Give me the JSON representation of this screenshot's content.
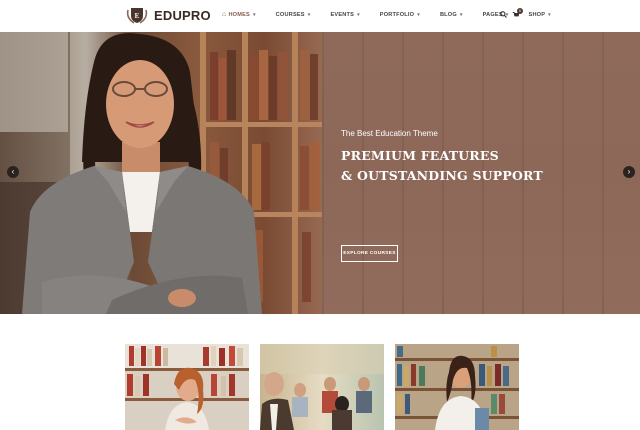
{
  "brand": {
    "name": "EDUPRO",
    "accent": "#8a5b4a"
  },
  "nav": {
    "items": [
      {
        "label": "HOMES",
        "active": true
      },
      {
        "label": "COURSES"
      },
      {
        "label": "EVENTS"
      },
      {
        "label": "PORTFOLIO"
      },
      {
        "label": "BLOG"
      },
      {
        "label": "PAGES"
      },
      {
        "label": "SHOP"
      }
    ],
    "cart_count": "0"
  },
  "hero": {
    "kicker": "The Best Education Theme",
    "title_line1": "PREMIUM FEATURES",
    "title_line2": "& OUTSTANDING SUPPORT",
    "button": "EXPLORE COURSES"
  },
  "colors": {
    "hero_overlay": "#8f6a5b",
    "dark": "#2b2320"
  }
}
